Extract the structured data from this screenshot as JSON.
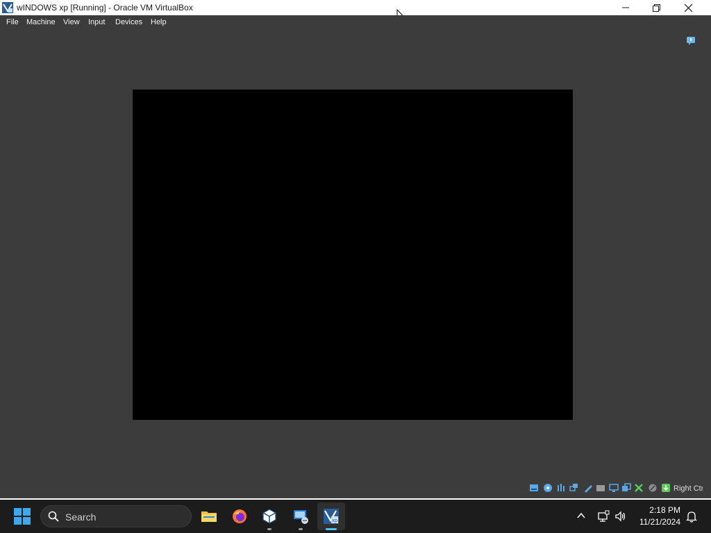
{
  "window": {
    "title": "wINDOWS xp [Running] - Oracle VM VirtualBox",
    "minimize_icon": "minimize-icon",
    "maximize_icon": "restore-icon",
    "close_icon": "close-icon"
  },
  "menubar": {
    "items": [
      "File",
      "Machine",
      "View",
      "Input",
      "Devices",
      "Help"
    ]
  },
  "vm": {
    "screen_state": "black"
  },
  "statusbar": {
    "icons": [
      "hard-disk-icon",
      "optical-drive-icon",
      "audio-icon",
      "network-icon",
      "usb-icon",
      "shared-folders-icon",
      "display-icon",
      "video-capture-icon",
      "guest-additions-icon",
      "cpu-icon",
      "mouse-integration-icon",
      "keyboard-icon"
    ],
    "host_key": "Right Ctrl"
  },
  "taskbar": {
    "search_placeholder": "Search",
    "apps": [
      {
        "name": "file-explorer",
        "running": false
      },
      {
        "name": "firefox",
        "running": false
      },
      {
        "name": "virtualbox-manager",
        "running": true
      },
      {
        "name": "remote-desktop",
        "running": true
      },
      {
        "name": "virtualbox-vm-xp",
        "running": true,
        "active": true
      }
    ],
    "clock": {
      "time": "2:18 PM",
      "date": "11/21/2024"
    }
  },
  "colors": {
    "window_bg": "#3c3c3c",
    "vm_screen": "#000000",
    "taskbar_bg": "#1c1c1c",
    "accent": "#4cc2ff"
  }
}
